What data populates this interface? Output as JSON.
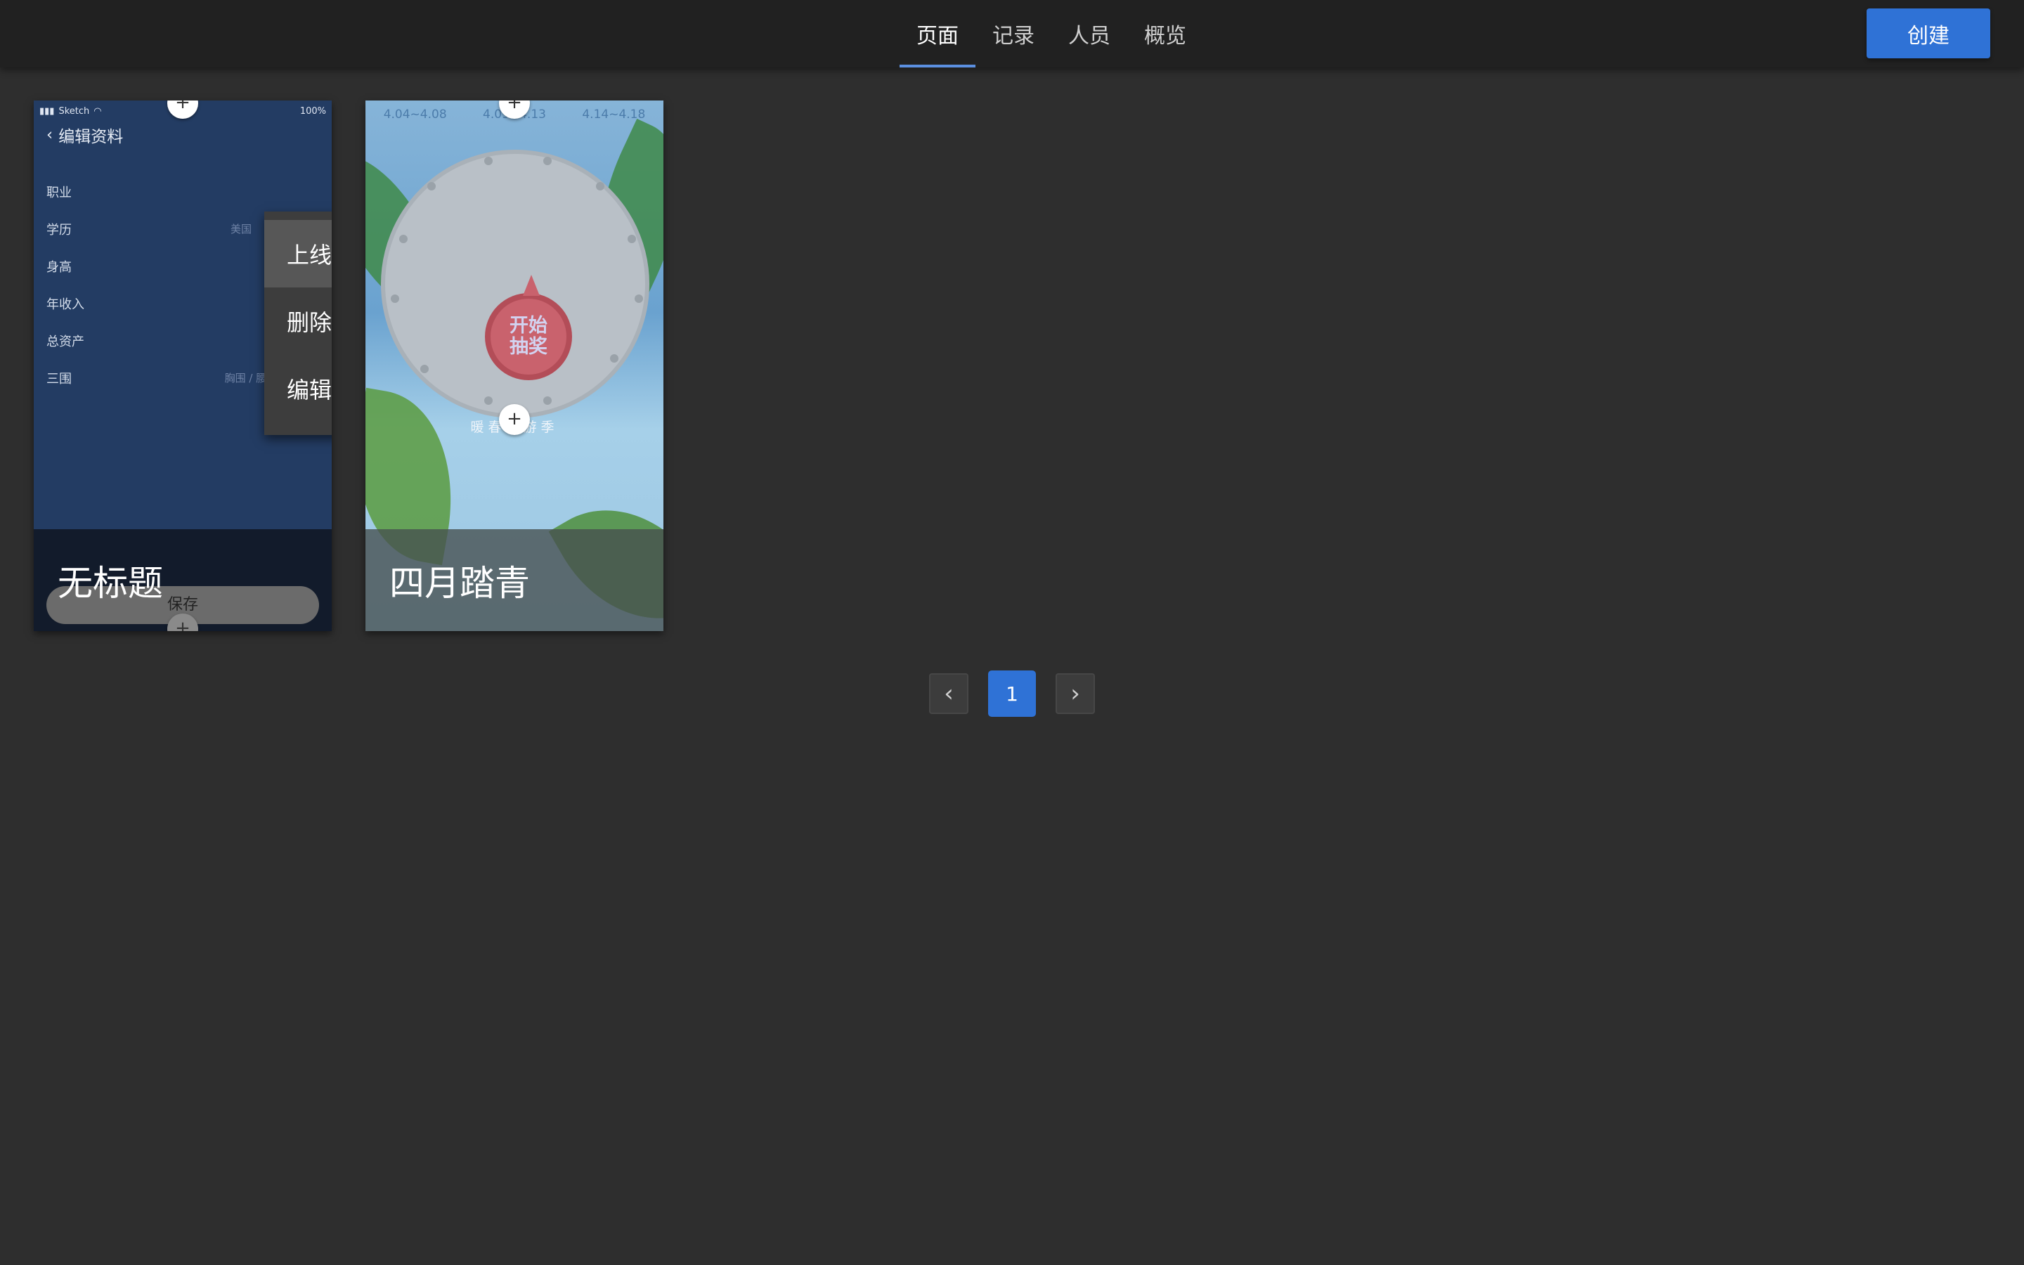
{
  "nav": {
    "tabs": [
      {
        "label": "页面",
        "active": true
      },
      {
        "label": "记录",
        "active": false
      },
      {
        "label": "人员",
        "active": false
      },
      {
        "label": "概览",
        "active": false
      }
    ],
    "create_label": "创建"
  },
  "cards": [
    {
      "title": "无标题",
      "preview": {
        "status_carrier": "Sketch",
        "status_battery": "100%",
        "header": "编辑资料",
        "fields": [
          {
            "label": "职业",
            "value": ""
          },
          {
            "label": "学历",
            "value": "美国"
          },
          {
            "label": "身高",
            "value": ""
          },
          {
            "label": "年收入",
            "value": ""
          },
          {
            "label": "总资产",
            "value": ""
          },
          {
            "label": "三围",
            "value": "胸围 / 腰围 / 臀围"
          }
        ],
        "save_label": "保存"
      },
      "menu": {
        "items": [
          "上线",
          "删除",
          "编辑"
        ]
      }
    },
    {
      "title": "四月踏青",
      "preview": {
        "dates": [
          "4.04~4.08",
          "4.09~4.13",
          "4.14~4.18"
        ],
        "start_label_line1": "开始",
        "start_label_line2": "抽奖",
        "slogan": "暖春出游季"
      }
    }
  ],
  "pagination": {
    "prev_icon": "‹",
    "current_page": "1",
    "next_icon": "›"
  },
  "colors": {
    "accent": "#2f72d6",
    "tab_indicator": "#5b8fe0",
    "background": "#2e2e2e",
    "topbar": "#212121"
  }
}
